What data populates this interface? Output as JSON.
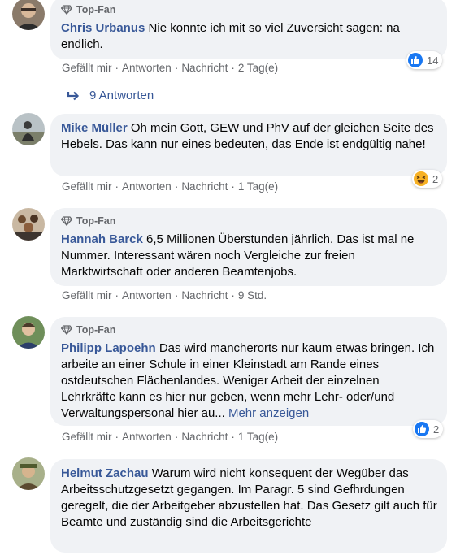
{
  "actions": {
    "like": "Gefällt mir",
    "reply": "Antworten",
    "message": "Nachricht",
    "separator": "·"
  },
  "comments": [
    {
      "badge": "Top-Fan",
      "author": "Chris Urbanus",
      "text": "Nie konnte ich mit so viel Zuversicht sagen: na endlich.",
      "time": "2 Tag(e)",
      "reaction": {
        "type": "like-icon",
        "count": "14"
      }
    },
    {
      "author": "Mike Müller",
      "text": "Oh mein Gott, GEW und PhV auf der gleichen Seite des Hebels. Das kann nur eines bedeuten, das Ende ist endgültig nahe!",
      "time": "1 Tag(e)",
      "reaction": {
        "type": "haha-icon",
        "count": "2"
      }
    },
    {
      "badge": "Top-Fan",
      "author": "Hannah Barck",
      "text": "6,5 Millionen Überstunden jährlich. Das ist mal ne Nummer. Interessant wären noch Vergleiche zur freien Marktwirtschaft oder anderen Beamtenjobs.",
      "time": "9 Std."
    },
    {
      "badge": "Top-Fan",
      "author": "Philipp Lapoehn",
      "text": "Das wird mancherorts nur kaum etwas bringen. Ich arbeite an einer Schule in einer Kleinstadt am Rande eines ostdeutschen Flächenlandes. Weniger Arbeit der einzelnen Lehrkräfte kann es hier nur geben, wenn mehr Lehr- oder/und Verwaltungspersonal hier au...",
      "more": "Mehr anzeigen",
      "time": "1 Tag(e)",
      "reaction": {
        "type": "like-icon",
        "count": "2"
      }
    },
    {
      "author": "Helmut Zachau",
      "text": "Warum wird nicht konsequent der Wegüber das Arbeitsschutzgesetzt gegangen. Im Paragr. 5 sind Gefhrdungen geregelt, die der Arbeitgeber abzustellen hat. Das Gesetz gilt auch für Beamte und zuständig sind die Arbeitsgerichte"
    }
  ],
  "replies": {
    "label": "9 Antworten"
  },
  "colors": {
    "link": "#385898",
    "bubble": "#f0f2f5",
    "meta": "#65676b",
    "like": "#1877f2"
  }
}
